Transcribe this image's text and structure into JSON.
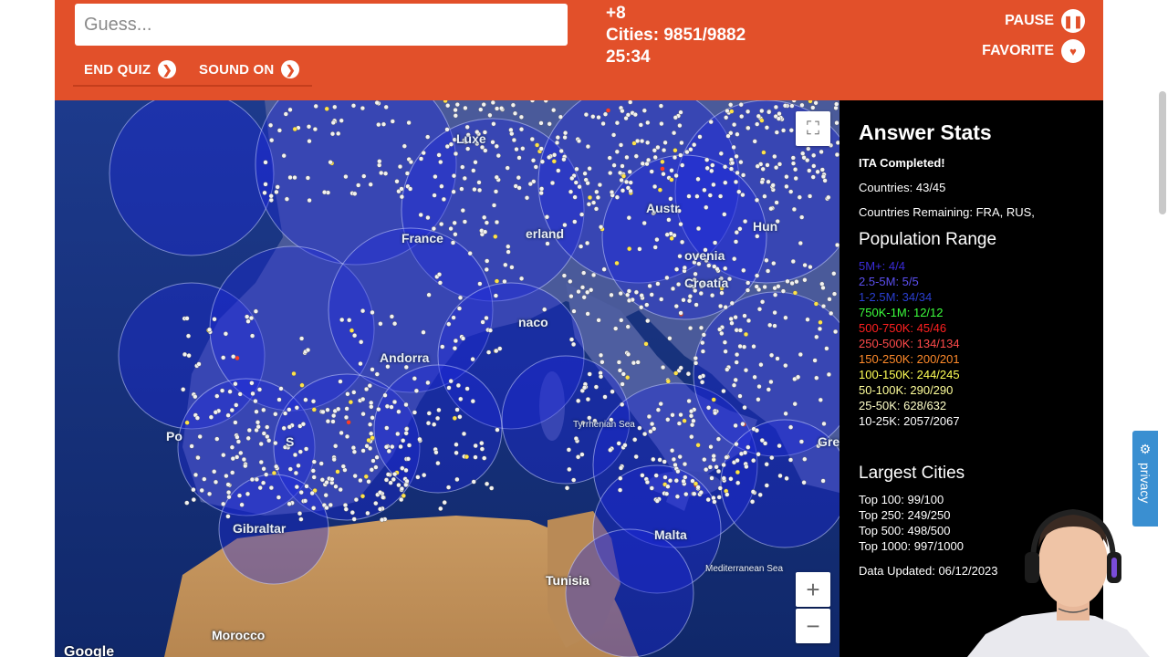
{
  "header": {
    "guess_placeholder": "Guess...",
    "end_quiz_label": "END QUIZ",
    "sound_label": "SOUND ON",
    "points": "+8",
    "cities_progress": "Cities: 9851/9882",
    "timer": "25:34",
    "pause_label": "PAUSE",
    "favorite_label": "FAVORITE"
  },
  "map": {
    "labels": {
      "luxembourg": "Luxe",
      "austria": "Austr",
      "hungary": "Hun",
      "france": "France",
      "switzerland": "erland",
      "slovenia": "ovenia",
      "croatia": "Croatia",
      "monaco": "naco",
      "andorra": "Andorra",
      "portugal": "Po",
      "spain": "S",
      "greece": "Gre",
      "tyrrhenian": "Tyrrhenian Sea",
      "gibraltar": "Gibraltar",
      "malta": "Malta",
      "mediterranean": "Mediterranean Sea",
      "tunisia": "Tunisia",
      "morocco": "Morocco"
    },
    "attribution": "Google",
    "zoom_in": "+",
    "zoom_out": "−"
  },
  "panel": {
    "title": "Answer Stats",
    "completed": "ITA Completed!",
    "countries": "Countries: 43/45",
    "countries_remaining": "Countries Remaining: FRA, RUS,",
    "population_title": "Population Range",
    "ranges": [
      {
        "text": "5M+: 4/4",
        "color": "#3a2bd8"
      },
      {
        "text": "2.5-5M: 5/5",
        "color": "#5b4ff0"
      },
      {
        "text": "1-2.5M: 34/34",
        "color": "#2a3fd0"
      },
      {
        "text": "750K-1M: 12/12",
        "color": "#3cff3c"
      },
      {
        "text": "500-750K: 45/46",
        "color": "#ff2020"
      },
      {
        "text": "250-500K: 134/134",
        "color": "#ff4a4a"
      },
      {
        "text": "150-250K: 200/201",
        "color": "#ff8a2a"
      },
      {
        "text": "100-150K: 244/245",
        "color": "#ffff55"
      },
      {
        "text": "50-100K: 290/290",
        "color": "#ffff9a"
      },
      {
        "text": "25-50K: 628/632",
        "color": "#ffffc8"
      },
      {
        "text": "10-25K: 2057/2067",
        "color": "#ffffff"
      }
    ],
    "largest_title": "Largest Cities",
    "largest": [
      {
        "text": "Top 100: 99/100"
      },
      {
        "text": "Top 250: 249/250"
      },
      {
        "text": "Top 500: 498/500"
      },
      {
        "text": "Top 1000: 997/1000"
      }
    ],
    "data_updated": "Data Updated: 06/12/2023"
  },
  "privacy": {
    "label": "privacy"
  }
}
